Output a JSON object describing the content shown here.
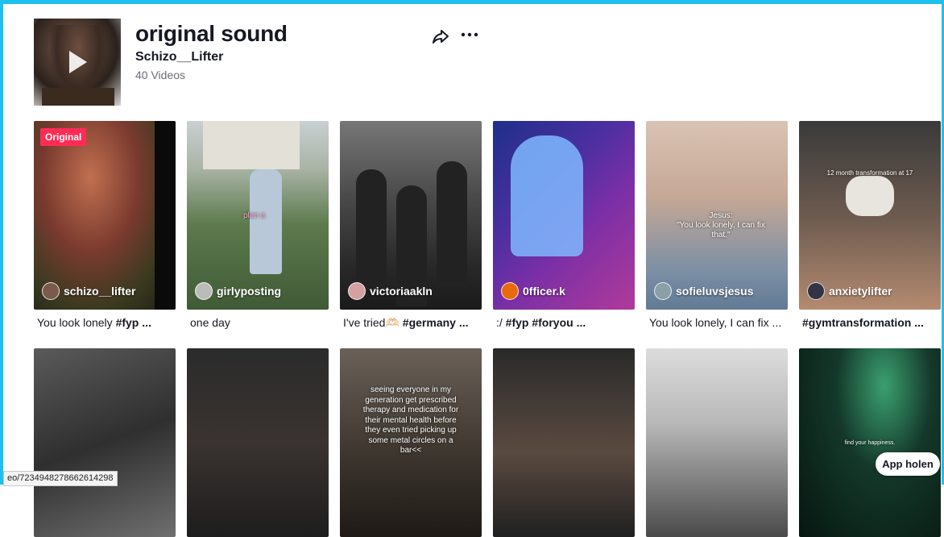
{
  "sound": {
    "title": "original sound",
    "author": "Schizo__Lifter",
    "video_count": "40 Videos"
  },
  "videos_row1": [
    {
      "user": "schizo__lifter",
      "caption_plain": "You look lonely ",
      "caption_bold": "#fyp ...",
      "badge": "Original"
    },
    {
      "user": "girlyposting",
      "caption_plain": "one day",
      "caption_bold": "",
      "overlay": "plan a"
    },
    {
      "user": "victoriaakln",
      "caption_plain": "I've tried🫶🏻 ",
      "caption_bold": "#germany ..."
    },
    {
      "user": "0fficer.k",
      "caption_plain": ":/ ",
      "caption_bold": "#fyp #foryou ..."
    },
    {
      "user": "sofieluvsjesus",
      "caption_plain": "You look lonely, I can fix ...",
      "caption_bold": "",
      "overlay": "Jesus:\n\"You look lonely, I can fix that.\""
    },
    {
      "user": "anxietylifter",
      "caption_plain": "",
      "caption_bold": "#gymtransformation ...",
      "overlay": "12 month transformation at 17"
    }
  ],
  "videos_row2": [
    {
      "overlay": ""
    },
    {
      "overlay": ""
    },
    {
      "overlay": "seeing everyone in my generation get prescribed therapy and medication for their mental health before they even tried picking up some metal circles on a bar<<"
    },
    {
      "overlay": ""
    },
    {
      "overlay": ""
    },
    {
      "overlay": "find your happiness."
    }
  ],
  "status_url": "eo/7234948278662614298",
  "app_button": "App holen",
  "colors": {
    "accent": "#fe2c55",
    "frame": "#1ec0f0"
  }
}
